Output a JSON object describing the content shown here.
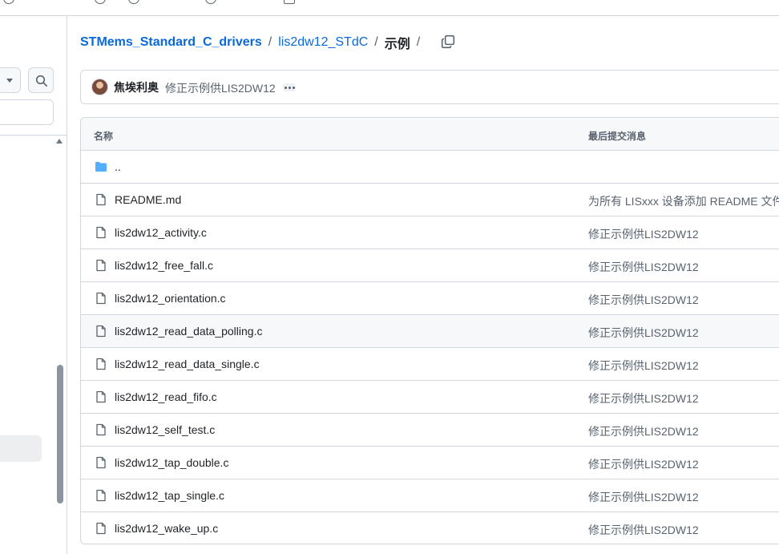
{
  "breadcrumb": {
    "root": "STMems_Standard_C_drivers",
    "dir": "lis2dw12_STdC",
    "current": "示例",
    "sep": "/"
  },
  "commit": {
    "author": "焦埃利奥",
    "message": "修正示例供LIS2DW12"
  },
  "table": {
    "col_name": "名称",
    "col_msg": "最后提交消息",
    "rows": [
      {
        "name": "..",
        "msg": "",
        "icon": "folder-icon"
      },
      {
        "name": "README.md",
        "msg": "为所有 LISxxx 设备添加 README 文件",
        "icon": "file-icon"
      },
      {
        "name": "lis2dw12_activity.c",
        "msg": "修正示例供LIS2DW12",
        "icon": "file-icon"
      },
      {
        "name": "lis2dw12_free_fall.c",
        "msg": "修正示例供LIS2DW12",
        "icon": "file-icon"
      },
      {
        "name": "lis2dw12_orientation.c",
        "msg": "修正示例供LIS2DW12",
        "icon": "file-icon"
      },
      {
        "name": "lis2dw12_read_data_polling.c",
        "msg": "修正示例供LIS2DW12",
        "icon": "file-icon"
      },
      {
        "name": "lis2dw12_read_data_single.c",
        "msg": "修正示例供LIS2DW12",
        "icon": "file-icon"
      },
      {
        "name": "lis2dw12_read_fifo.c",
        "msg": "修正示例供LIS2DW12",
        "icon": "file-icon"
      },
      {
        "name": "lis2dw12_self_test.c",
        "msg": "修正示例供LIS2DW12",
        "icon": "file-icon"
      },
      {
        "name": "lis2dw12_tap_double.c",
        "msg": "修正示例供LIS2DW12",
        "icon": "file-icon"
      },
      {
        "name": "lis2dw12_tap_single.c",
        "msg": "修正示例供LIS2DW12",
        "icon": "file-icon"
      },
      {
        "name": "lis2dw12_wake_up.c",
        "msg": "修正示例供LIS2DW12",
        "icon": "file-icon"
      }
    ]
  },
  "colors": {
    "link": "#0969da",
    "folder": "#54aeff",
    "muted": "#59636e",
    "border": "#d0d7de"
  }
}
